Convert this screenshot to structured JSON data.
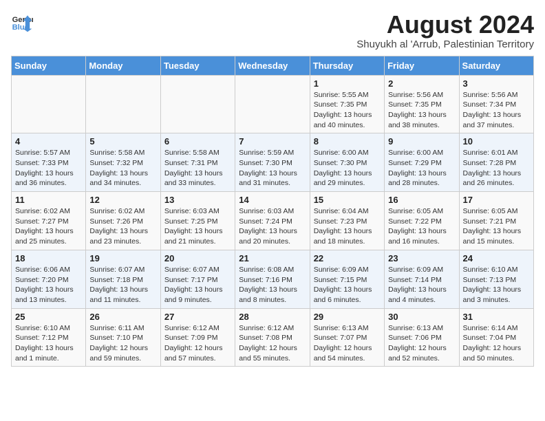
{
  "logo": {
    "line1": "General",
    "line2": "Blue"
  },
  "title": "August 2024",
  "subtitle": "Shuyukh al 'Arrub, Palestinian Territory",
  "days_header": [
    "Sunday",
    "Monday",
    "Tuesday",
    "Wednesday",
    "Thursday",
    "Friday",
    "Saturday"
  ],
  "weeks": [
    [
      {
        "day": "",
        "info": ""
      },
      {
        "day": "",
        "info": ""
      },
      {
        "day": "",
        "info": ""
      },
      {
        "day": "",
        "info": ""
      },
      {
        "day": "1",
        "info": "Sunrise: 5:55 AM\nSunset: 7:35 PM\nDaylight: 13 hours\nand 40 minutes."
      },
      {
        "day": "2",
        "info": "Sunrise: 5:56 AM\nSunset: 7:35 PM\nDaylight: 13 hours\nand 38 minutes."
      },
      {
        "day": "3",
        "info": "Sunrise: 5:56 AM\nSunset: 7:34 PM\nDaylight: 13 hours\nand 37 minutes."
      }
    ],
    [
      {
        "day": "4",
        "info": "Sunrise: 5:57 AM\nSunset: 7:33 PM\nDaylight: 13 hours\nand 36 minutes."
      },
      {
        "day": "5",
        "info": "Sunrise: 5:58 AM\nSunset: 7:32 PM\nDaylight: 13 hours\nand 34 minutes."
      },
      {
        "day": "6",
        "info": "Sunrise: 5:58 AM\nSunset: 7:31 PM\nDaylight: 13 hours\nand 33 minutes."
      },
      {
        "day": "7",
        "info": "Sunrise: 5:59 AM\nSunset: 7:30 PM\nDaylight: 13 hours\nand 31 minutes."
      },
      {
        "day": "8",
        "info": "Sunrise: 6:00 AM\nSunset: 7:30 PM\nDaylight: 13 hours\nand 29 minutes."
      },
      {
        "day": "9",
        "info": "Sunrise: 6:00 AM\nSunset: 7:29 PM\nDaylight: 13 hours\nand 28 minutes."
      },
      {
        "day": "10",
        "info": "Sunrise: 6:01 AM\nSunset: 7:28 PM\nDaylight: 13 hours\nand 26 minutes."
      }
    ],
    [
      {
        "day": "11",
        "info": "Sunrise: 6:02 AM\nSunset: 7:27 PM\nDaylight: 13 hours\nand 25 minutes."
      },
      {
        "day": "12",
        "info": "Sunrise: 6:02 AM\nSunset: 7:26 PM\nDaylight: 13 hours\nand 23 minutes."
      },
      {
        "day": "13",
        "info": "Sunrise: 6:03 AM\nSunset: 7:25 PM\nDaylight: 13 hours\nand 21 minutes."
      },
      {
        "day": "14",
        "info": "Sunrise: 6:03 AM\nSunset: 7:24 PM\nDaylight: 13 hours\nand 20 minutes."
      },
      {
        "day": "15",
        "info": "Sunrise: 6:04 AM\nSunset: 7:23 PM\nDaylight: 13 hours\nand 18 minutes."
      },
      {
        "day": "16",
        "info": "Sunrise: 6:05 AM\nSunset: 7:22 PM\nDaylight: 13 hours\nand 16 minutes."
      },
      {
        "day": "17",
        "info": "Sunrise: 6:05 AM\nSunset: 7:21 PM\nDaylight: 13 hours\nand 15 minutes."
      }
    ],
    [
      {
        "day": "18",
        "info": "Sunrise: 6:06 AM\nSunset: 7:20 PM\nDaylight: 13 hours\nand 13 minutes."
      },
      {
        "day": "19",
        "info": "Sunrise: 6:07 AM\nSunset: 7:18 PM\nDaylight: 13 hours\nand 11 minutes."
      },
      {
        "day": "20",
        "info": "Sunrise: 6:07 AM\nSunset: 7:17 PM\nDaylight: 13 hours\nand 9 minutes."
      },
      {
        "day": "21",
        "info": "Sunrise: 6:08 AM\nSunset: 7:16 PM\nDaylight: 13 hours\nand 8 minutes."
      },
      {
        "day": "22",
        "info": "Sunrise: 6:09 AM\nSunset: 7:15 PM\nDaylight: 13 hours\nand 6 minutes."
      },
      {
        "day": "23",
        "info": "Sunrise: 6:09 AM\nSunset: 7:14 PM\nDaylight: 13 hours\nand 4 minutes."
      },
      {
        "day": "24",
        "info": "Sunrise: 6:10 AM\nSunset: 7:13 PM\nDaylight: 13 hours\nand 3 minutes."
      }
    ],
    [
      {
        "day": "25",
        "info": "Sunrise: 6:10 AM\nSunset: 7:12 PM\nDaylight: 13 hours\nand 1 minute."
      },
      {
        "day": "26",
        "info": "Sunrise: 6:11 AM\nSunset: 7:10 PM\nDaylight: 12 hours\nand 59 minutes."
      },
      {
        "day": "27",
        "info": "Sunrise: 6:12 AM\nSunset: 7:09 PM\nDaylight: 12 hours\nand 57 minutes."
      },
      {
        "day": "28",
        "info": "Sunrise: 6:12 AM\nSunset: 7:08 PM\nDaylight: 12 hours\nand 55 minutes."
      },
      {
        "day": "29",
        "info": "Sunrise: 6:13 AM\nSunset: 7:07 PM\nDaylight: 12 hours\nand 54 minutes."
      },
      {
        "day": "30",
        "info": "Sunrise: 6:13 AM\nSunset: 7:06 PM\nDaylight: 12 hours\nand 52 minutes."
      },
      {
        "day": "31",
        "info": "Sunrise: 6:14 AM\nSunset: 7:04 PM\nDaylight: 12 hours\nand 50 minutes."
      }
    ]
  ]
}
